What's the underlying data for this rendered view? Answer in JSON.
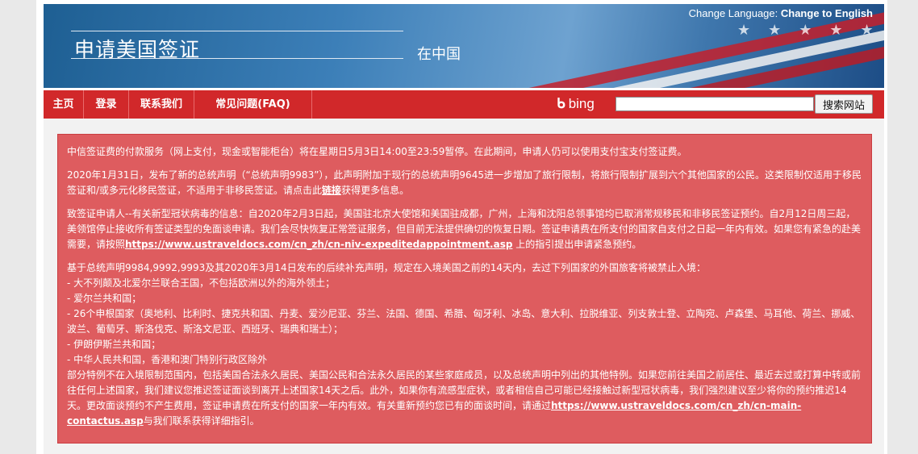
{
  "header": {
    "title": "申请美国签证",
    "subtitle": "在中国",
    "lang_prefix": "Change Language: ",
    "lang_link": "Change to English"
  },
  "nav": {
    "items": [
      {
        "label": "主页"
      },
      {
        "label": "登录"
      },
      {
        "label": "联系我们"
      },
      {
        "label": "常见问题(FAQ)"
      }
    ],
    "bing_label": "bing",
    "search_value": "",
    "search_button": "搜索网站"
  },
  "notice": {
    "p1": "中信签证费的付款服务（网上支付，现金或智能柜台）将在星期日5月3日14:00至23:59暂停。在此期间，申请人仍可以使用支付宝支付签证费。",
    "p2_a": "2020年1月31日，发布了新的总统声明（“总统声明9983”），此声明附加于现行的总统声明9645进一步增加了旅行限制，将旅行限制扩展到六个其他国家的公民。这类限制仅适用于移民签证和/或多元化移民签证，不适用于非移民签证。请点击此",
    "p2_link": "链接",
    "p2_b": "获得更多信息。",
    "p3_a": "致签证申请人--有关新型冠状病毒的信息：自2020年2月3日起，美国驻北京大使馆和美国驻成都，广州，上海和沈阳总领事馆均已取消常规移民和非移民签证预约。自2月12日周三起，美领馆停止接收所有签证类型的免面谈申请。我们会尽快恢复正常签证服务，但目前无法提供确切的恢复日期。签证申请费在所支付的国家自支付之日起一年内有效。如果您有紧急的赴美需要，请按照",
    "p3_link": "https://www.ustraveldocs.com/cn_zh/cn-niv-expeditedappointment.asp",
    "p3_b": " 上的指引提出申请紧急预约。",
    "p4_intro": "基于总统声明9984,9992,9993及其2020年3月14日发布的后续补充声明，规定在入境美国之前的14天内，去过下列国家的外国旅客将被禁止入境：",
    "p4_list": [
      "- 大不列颠及北爱尔兰联合王国，不包括欧洲以外的海外领土；",
      "- 爱尔兰共和国；",
      "- 26个申根国家（奥地利、比利时、捷克共和国、丹麦、爱沙尼亚、芬兰、法国、德国、希腊、匈牙利、冰岛、意大利、拉脱维亚、列支敦士登、立陶宛、卢森堡、马耳他、荷兰、挪威、波兰、葡萄牙、斯洛伐克、斯洛文尼亚、西班牙、瑞典和瑞士）；",
      "- 伊朗伊斯兰共和国；",
      "- 中华人民共和国，香港和澳门特别行政区除外"
    ],
    "p4_tail": "部分特例不在入境限制范围内，包括美国合法永久居民、美国公民和合法永久居民的某些家庭成员，以及总统声明中列出的其他特例。如果您前往美国之前居住、最近去过或打算中转或前往任何上述国家，我们建议您推迟签证面谈到离开上述国家14天之后。此外，如果你有流感型症状，或者相信自己可能已经接触过新型冠状病毒，我们强烈建议至少将你的预约推迟14天。更改面谈预约不产生费用，签证申请费在所支付的国家一年内有效。有关重新预约您已有的面谈时间，请通过",
    "p4_link": "https://www.ustraveldocs.com/cn_zh/cn-main-contactus.asp",
    "p4_end": "与我们联系获得详细指引。"
  },
  "colors": {
    "nav_red": "#d1282a",
    "notice_bg": "#de5c5f",
    "banner_blue": "#2f6da4"
  }
}
